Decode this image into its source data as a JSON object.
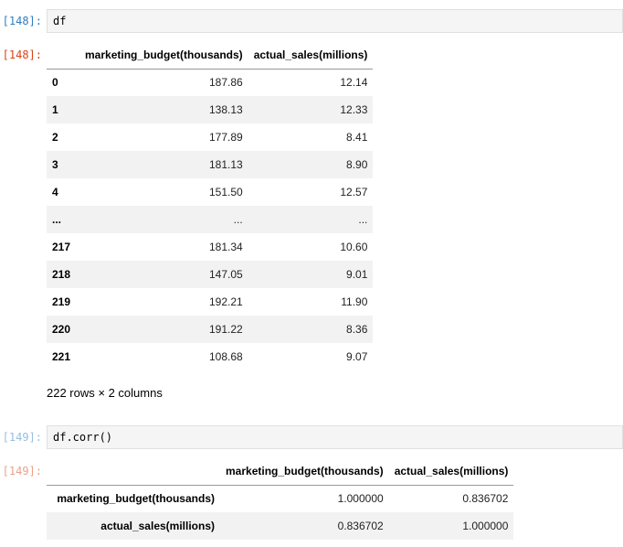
{
  "cell148": {
    "in_prompt": "[148]:",
    "code": "df",
    "out_prompt": "[148]:",
    "table": {
      "columns": [
        "marketing_budget(thousands)",
        "actual_sales(millions)"
      ],
      "rows": [
        {
          "index": "0",
          "values": [
            "187.86",
            "12.14"
          ]
        },
        {
          "index": "1",
          "values": [
            "138.13",
            "12.33"
          ]
        },
        {
          "index": "2",
          "values": [
            "177.89",
            "8.41"
          ]
        },
        {
          "index": "3",
          "values": [
            "181.13",
            "8.90"
          ]
        },
        {
          "index": "4",
          "values": [
            "151.50",
            "12.57"
          ]
        },
        {
          "index": "...",
          "values": [
            "...",
            "..."
          ]
        },
        {
          "index": "217",
          "values": [
            "181.34",
            "10.60"
          ]
        },
        {
          "index": "218",
          "values": [
            "147.05",
            "9.01"
          ]
        },
        {
          "index": "219",
          "values": [
            "192.21",
            "11.90"
          ]
        },
        {
          "index": "220",
          "values": [
            "191.22",
            "8.36"
          ]
        },
        {
          "index": "221",
          "values": [
            "108.68",
            "9.07"
          ]
        }
      ]
    },
    "summary": "222 rows × 2 columns"
  },
  "cell149": {
    "in_prompt": "[149]:",
    "code": "df.corr()",
    "out_prompt": "[149]:",
    "table": {
      "columns": [
        "marketing_budget(thousands)",
        "actual_sales(millions)"
      ],
      "rows": [
        {
          "index": "marketing_budget(thousands)",
          "values": [
            "1.000000",
            "0.836702"
          ]
        },
        {
          "index": "actual_sales(millions)",
          "values": [
            "0.836702",
            "1.000000"
          ]
        }
      ]
    }
  }
}
